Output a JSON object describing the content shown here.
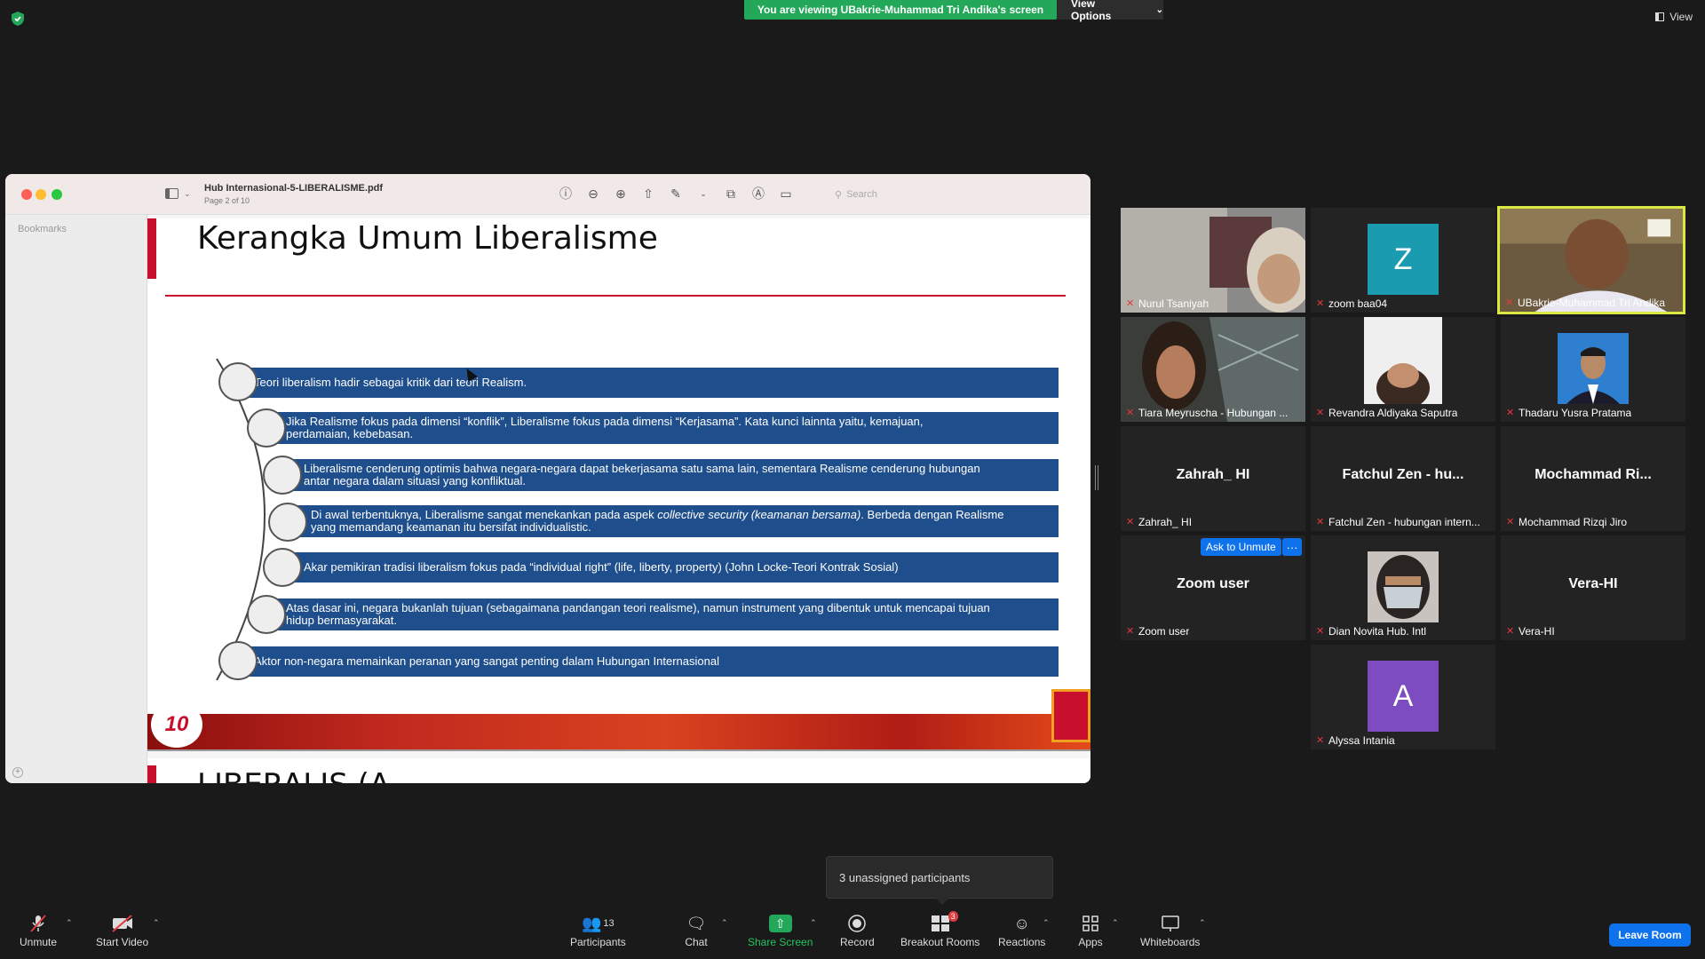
{
  "banner": {
    "viewing_text": "You are viewing UBakrie-Muhammad Tri Andika's screen",
    "view_options": "View Options",
    "view": "View"
  },
  "preview": {
    "doc_title": "Hub Internasional-5-LIBERALISME.pdf",
    "page_info": "Page 2 of 10",
    "search_placeholder": "Search",
    "bookmarks_label": "Bookmarks"
  },
  "slide": {
    "title": "Kerangka Umum Liberalisme",
    "items": [
      {
        "text": "Teori liberalism hadir sebagai kritik dari teori Realism."
      },
      {
        "line1": "Jika Realisme fokus pada dimensi “konflik”, Liberalisme fokus pada dimensi “Kerjasama”. Kata kunci lainnta yaitu, kemajuan,",
        "line2": "perdamaian, kebebasan."
      },
      {
        "line1": "Liberalisme cenderung optimis bahwa negara-negara dapat bekerjasama satu sama lain, sementara Realisme cenderung hubungan",
        "line2": "antar negara dalam situasi yang konfliktual."
      },
      {
        "line1a": "Di awal terbentuknya, Liberalisme sangat menekankan pada aspek ",
        "line1b": "collective security (keamanan bersama)",
        "line1c": ". Berbeda dengan Realisme",
        "line2": "yang memandang keamanan itu bersifat individualistic."
      },
      {
        "text": "Akar pemikiran tradisi liberalism fokus pada “individual right” (life, liberty, property) (John Locke-Teori Kontrak Sosial)"
      },
      {
        "line1": "Atas dasar ini, negara bukanlah tujuan (sebagaimana pandangan teori realisme), namun instrument yang dibentuk untuk mencapai tujuan",
        "line2": "hidup bermasyarakat."
      },
      {
        "text": "Aktor non-negara memainkan peranan yang sangat penting dalam Hubungan Internasional"
      }
    ],
    "next_title": "LIBERALIS (A...",
    "logo_text": "10"
  },
  "participants": [
    {
      "name": "Nurul Tsaniyah",
      "kind": "video"
    },
    {
      "name": "zoom baa04",
      "kind": "avatar",
      "letter": "Z",
      "color": "#1a9bb0"
    },
    {
      "name": "UBakrie-Muhammad Tri Andika",
      "kind": "video",
      "active": true
    },
    {
      "name": "Tiara Meyruscha - Hubungan ...",
      "kind": "video"
    },
    {
      "name": "Revandra Aldiyaka Saputra",
      "kind": "photo"
    },
    {
      "name": "Thadaru Yusra Pratama",
      "kind": "photo"
    },
    {
      "name": "Zahrah_ HI",
      "kind": "text",
      "center": "Zahrah_ HI"
    },
    {
      "name": "Fatchul Zen - hubungan intern...",
      "kind": "text",
      "center": "Fatchul Zen - hu..."
    },
    {
      "name": "Mochammad Rizqi Jiro",
      "kind": "text",
      "center": "Mochammad  Ri..."
    },
    {
      "name": "Zoom user",
      "kind": "text",
      "center": "Zoom user"
    },
    {
      "name": "Dian Novita Hub. Intl",
      "kind": "photo"
    },
    {
      "name": "Vera-HI",
      "kind": "text",
      "center": "Vera-HI"
    },
    {
      "name": "Alyssa Intania",
      "kind": "avatar",
      "letter": "A",
      "color": "#7d4cc0"
    }
  ],
  "ask_to_unmute": "Ask to Unmute",
  "ask_more": "···",
  "toast": "3 unassigned participants",
  "toolbar": {
    "unmute": "Unmute",
    "start_video": "Start Video",
    "participants": "Participants",
    "participants_count": "13",
    "chat": "Chat",
    "share_screen": "Share Screen",
    "record": "Record",
    "breakout_rooms": "Breakout Rooms",
    "breakout_badge": "3",
    "reactions": "Reactions",
    "apps": "Apps",
    "whiteboards": "Whiteboards",
    "leave_room": "Leave Room"
  },
  "colors": {
    "accent_green": "#23a85a",
    "zoom_blue": "#0e72ed",
    "slide_blue": "#1f4e8c",
    "slide_red": "#c8102e",
    "active_speaker": "#d9e843",
    "muted_red": "#e0393e"
  }
}
